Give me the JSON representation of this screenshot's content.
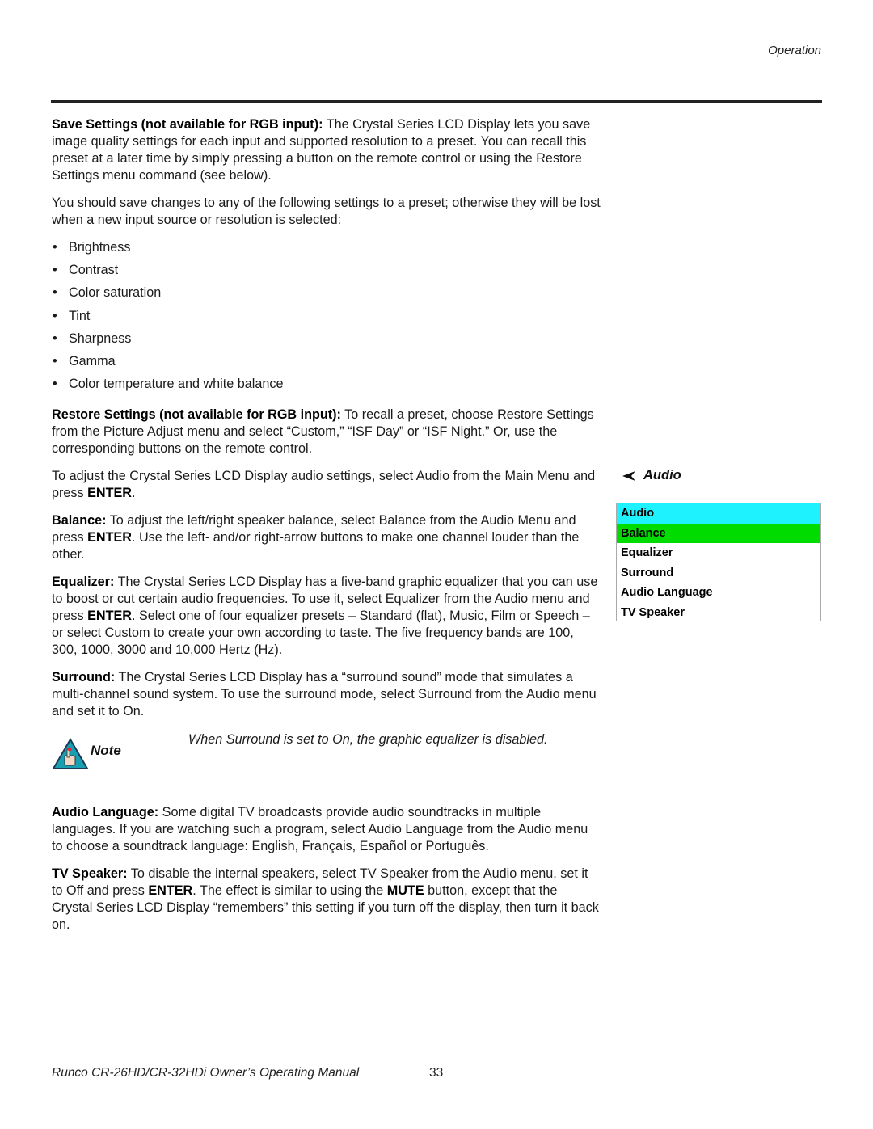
{
  "header": {
    "section": "Operation"
  },
  "save_settings": {
    "term": "Save Settings (not available for RGB input):",
    "text": " The Crystal Series LCD Display lets you save image quality settings for each input and supported resolution to a preset. You can recall this preset at a later time by simply pressing a button on the remote control or using the Restore Settings menu command (see below)."
  },
  "save_intro": "You should save changes to any of the following settings to a preset; otherwise they will be lost when a new input source or resolution is selected:",
  "settings_list": [
    "Brightness",
    "Contrast",
    "Color saturation",
    "Tint",
    "Sharpness",
    "Gamma",
    "Color temperature and white balance"
  ],
  "restore_settings": {
    "term": "Restore Settings (not available for RGB input):",
    "text": " To recall a preset, choose Restore Settings from the Picture Adjust menu and select “Custom,” “ISF Day” or “ISF Night.” Or, use the corresponding buttons on the remote control."
  },
  "audio_intro": {
    "pre": "To adjust the Crystal Series LCD Display audio settings, select Audio from the Main Menu and press ",
    "bold": "ENTER",
    "post": "."
  },
  "balance": {
    "term": "Balance:",
    "pre": " To adjust the left/right speaker balance, select Balance from the Audio Menu and press ",
    "bold": "ENTER",
    "post": ". Use the left- and/or right-arrow buttons to make one channel louder than the other."
  },
  "equalizer": {
    "term": "Equalizer:",
    "pre": " The Crystal Series LCD Display has a five-band graphic equalizer that you can use to boost or cut certain audio frequencies. To use it, select Equalizer from the Audio menu and press ",
    "bold": "ENTER",
    "post": ". Select one of four equalizer presets – Standard (flat), Music, Film or Speech – or select Custom to create your own according to taste. The five frequency bands are 100, 300, 1000, 3000 and 10,000 Hertz (Hz)."
  },
  "surround": {
    "term": "Surround:",
    "text": " The Crystal Series LCD Display has a “surround sound” mode that simulates a multi-channel sound system. To use the surround mode, select Surround from the Audio menu and set it to On."
  },
  "note": {
    "label": "Note",
    "text": "When Surround is set to On, the graphic equalizer is disabled."
  },
  "audio_language": {
    "term": "Audio Language:",
    "text": " Some digital TV broadcasts provide audio soundtracks in multiple languages. If you are watching such a program, select Audio Language from the Audio menu to choose a soundtrack language: English, Français, Español or Português."
  },
  "tv_speaker": {
    "term": "TV Speaker:",
    "pre": " To disable the internal speakers, select TV Speaker from the Audio menu, set it to Off and press ",
    "bold1": "ENTER",
    "mid": ". The effect is similar to using the ",
    "bold2": "MUTE",
    "post": " button, except that the Crystal Series LCD Display “remembers” this setting if you turn off the display, then turn it back on."
  },
  "sidebar": {
    "heading": "Audio",
    "menu": {
      "title": "Audio",
      "items": [
        "Balance",
        "Equalizer",
        "Surround",
        "Audio Language",
        "TV Speaker"
      ],
      "selected": "Balance",
      "colors": {
        "title_bg": "#1ef2ff",
        "selected_bg": "#00dc00"
      }
    }
  },
  "footer": {
    "manual_title": "Runco CR-26HD/CR-32HDi Owner’s Operating Manual",
    "page_number": "33"
  }
}
